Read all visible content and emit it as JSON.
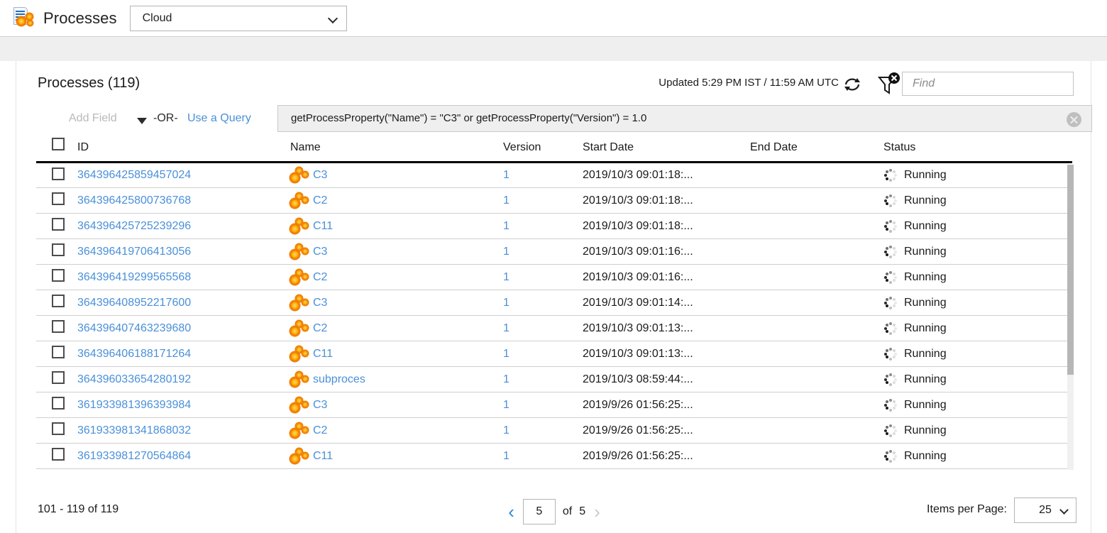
{
  "topbar": {
    "app_icon": "processes-document-gears-icon",
    "title": "Processes",
    "environment_select": {
      "value": "Cloud",
      "options": [
        "Cloud"
      ]
    }
  },
  "card": {
    "page_title": "Processes (119)",
    "updated_text": "Updated 5:29 PM IST / 11:59 AM UTC",
    "refresh_icon": "refresh-icon",
    "filter_icon": "filter-clear-icon",
    "find": {
      "value": "",
      "placeholder": "Find"
    }
  },
  "query_bar": {
    "add_field_label": "Add Field",
    "caret_icon": "chevron-down-icon",
    "or_label": "-OR-",
    "use_a_query_label": "Use a Query",
    "query_value": "getProcessProperty(\"Name\") = \"C3\" or  getProcessProperty(\"Version\") = 1.0",
    "clear_icon": "clear-query-icon"
  },
  "table": {
    "select_all_checkbox": false,
    "columns": [
      "ID",
      "Name",
      "Version",
      "Start Date",
      "End Date",
      "Status"
    ],
    "rows": [
      {
        "id": "364396425859457024",
        "name": "C3",
        "version": "1",
        "start": "2019/10/3 09:01:18:...",
        "end": "",
        "status": "Running"
      },
      {
        "id": "364396425800736768",
        "name": "C2",
        "version": "1",
        "start": "2019/10/3 09:01:18:...",
        "end": "",
        "status": "Running"
      },
      {
        "id": "364396425725239296",
        "name": "C11",
        "version": "1",
        "start": "2019/10/3 09:01:18:...",
        "end": "",
        "status": "Running"
      },
      {
        "id": "364396419706413056",
        "name": "C3",
        "version": "1",
        "start": "2019/10/3 09:01:16:...",
        "end": "",
        "status": "Running"
      },
      {
        "id": "364396419299565568",
        "name": "C2",
        "version": "1",
        "start": "2019/10/3 09:01:16:...",
        "end": "",
        "status": "Running"
      },
      {
        "id": "364396408952217600",
        "name": "C3",
        "version": "1",
        "start": "2019/10/3 09:01:14:...",
        "end": "",
        "status": "Running"
      },
      {
        "id": "364396407463239680",
        "name": "C2",
        "version": "1",
        "start": "2019/10/3 09:01:13:...",
        "end": "",
        "status": "Running"
      },
      {
        "id": "364396406188171264",
        "name": "C11",
        "version": "1",
        "start": "2019/10/3 09:01:13:...",
        "end": "",
        "status": "Running"
      },
      {
        "id": "364396033654280192",
        "name": "subproces",
        "version": "1",
        "start": "2019/10/3 08:59:44:...",
        "end": "",
        "status": "Running"
      },
      {
        "id": "361933981396393984",
        "name": "C3",
        "version": "1",
        "start": "2019/9/26 01:56:25:...",
        "end": "",
        "status": "Running"
      },
      {
        "id": "361933981341868032",
        "name": "C2",
        "version": "1",
        "start": "2019/9/26 01:56:25:...",
        "end": "",
        "status": "Running"
      },
      {
        "id": "361933981270564864",
        "name": "C11",
        "version": "1",
        "start": "2019/9/26 01:56:25:...",
        "end": "",
        "status": "Running"
      }
    ]
  },
  "footer": {
    "range_text": "101 - 119  of  119",
    "prev_icon": "chevron-left-icon",
    "next_icon": "chevron-right-icon",
    "page_value": "5",
    "of_label": "of",
    "page_total": "5",
    "items_per_page_label": "Items per Page:",
    "items_per_page_value": "25"
  },
  "colors": {
    "link": "#4a90d9",
    "accent_orange": "#f07c00",
    "band": "#efefef",
    "query_field": "#efefef"
  }
}
